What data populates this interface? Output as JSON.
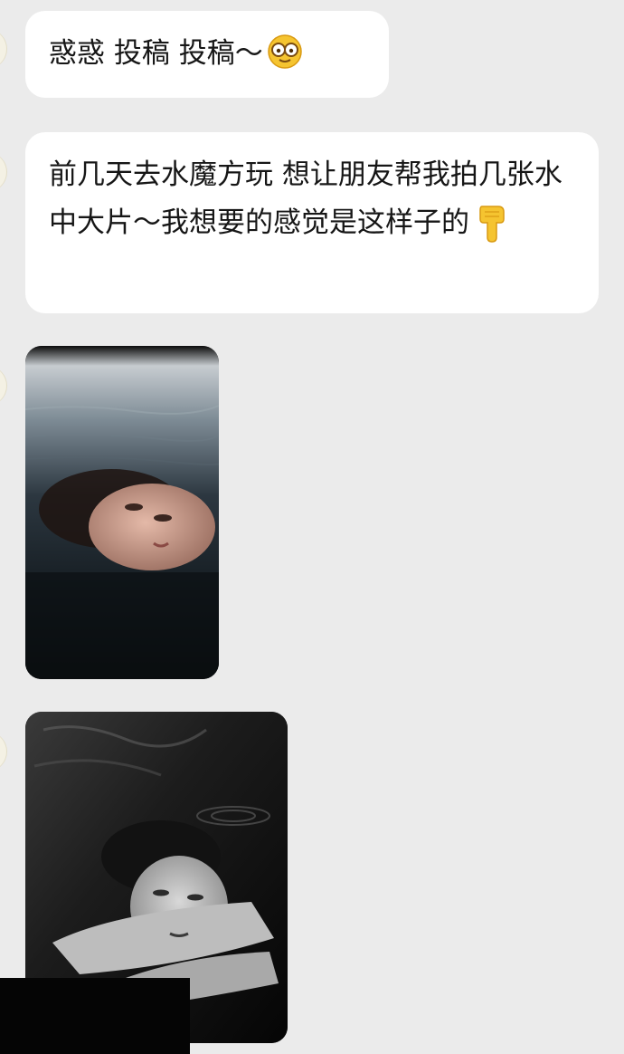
{
  "messages": [
    {
      "type": "text",
      "text": "惑惑 投稿 投稿～",
      "emoji": "nerd-glasses-emoji"
    },
    {
      "type": "text",
      "text": "前几天去水魔方玩 想让朋友帮我拍几张水中大片～我想要的感觉是这样子的",
      "emoji": "pointing-down-hand-emoji"
    },
    {
      "type": "image",
      "subject": "woman-floating-in-water-color-photo"
    },
    {
      "type": "image",
      "subject": "woman-in-water-black-and-white-photo"
    }
  ],
  "colors": {
    "background": "#ebebeb",
    "bubble": "#ffffff",
    "text": "#161616",
    "emoji_yellow": "#f5c430"
  }
}
